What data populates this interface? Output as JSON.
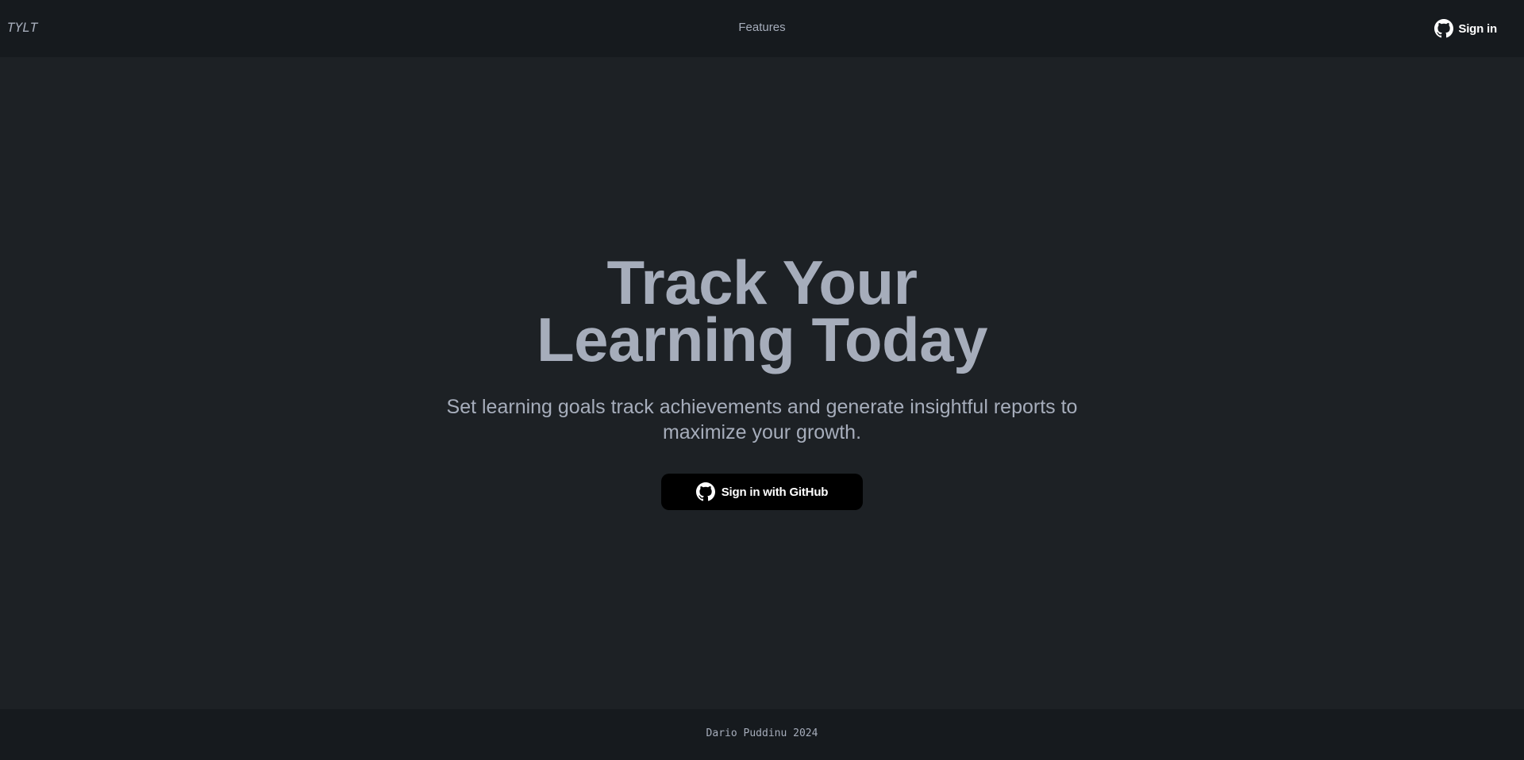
{
  "header": {
    "brand": "TYLT",
    "nav_features": "Features",
    "signin_label": "Sign in",
    "signin_icon": "github-icon"
  },
  "hero": {
    "title_line1": "Track Your",
    "title_line2": "Learning Today",
    "subtitle": "Set learning goals track achievements and generate insightful reports to maximize your growth.",
    "cta_label": "Sign in with GitHub",
    "cta_icon": "github-icon"
  },
  "footer": {
    "text": "Dario Puddinu 2024"
  },
  "colors": {
    "background": "#1d2125",
    "header_footer": "#161a1e",
    "text": "#a6adbb",
    "cta_bg": "#000000",
    "cta_text": "#ffffff"
  }
}
